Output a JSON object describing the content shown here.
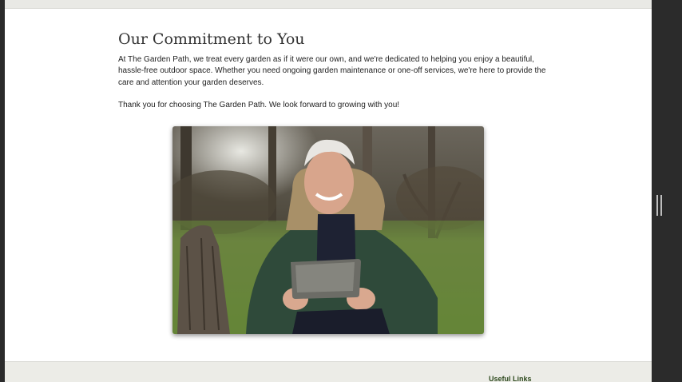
{
  "content": {
    "heading": "Our Commitment to You",
    "paragraph": "At The Garden Path, we treat every garden as if it were our own, and we're dedicated to helping you enjoy a beautiful, hassle-free outdoor space. Whether you need ongoing garden maintenance or one-off services, we're here to provide the care and attention your garden deserves.",
    "thanks": "Thank you for choosing The Garden Path. We look forward to growing with you!"
  },
  "footer": {
    "title": "Useful Links"
  },
  "colors": {
    "page_bg": "#ffffff",
    "frame": "#2b2b2b",
    "footer_bg": "#ecece7",
    "footer_title": "#2e4a1e"
  },
  "icons": {
    "splitter": "vertical-drag-handle-icon"
  }
}
